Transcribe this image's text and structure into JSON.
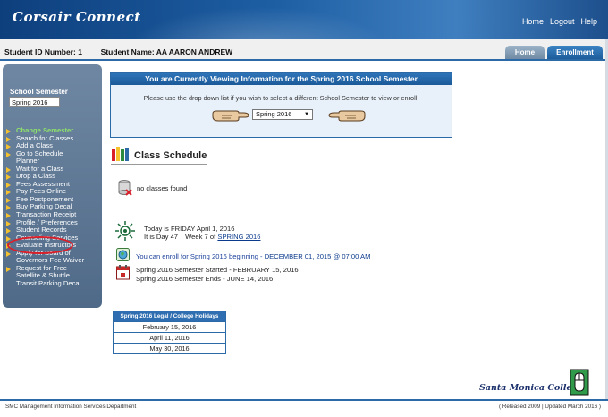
{
  "header": {
    "logo_text": "Corsair Connect",
    "nav": [
      "Home",
      "Logout",
      "Help"
    ]
  },
  "student": {
    "id_label": "Student ID Number:",
    "id_value": "1",
    "name_label": "Student Name:",
    "name_value": "AA AARON ANDREW"
  },
  "tabs": [
    "Home",
    "Enrollment"
  ],
  "sidebar": {
    "semester_label": "School Semester",
    "semester_value": "Spring 2016",
    "menu": [
      {
        "label": "Change Semester",
        "arrow": true
      },
      {
        "label": "Search for Classes",
        "arrow": true
      },
      {
        "label": "Add a Class",
        "arrow": true
      },
      {
        "label": "Go to Schedule",
        "arrow": true
      },
      {
        "label": "Planner",
        "arrow": false
      },
      {
        "label": "Wait for a Class",
        "arrow": true
      },
      {
        "label": "Drop a Class",
        "arrow": true
      },
      {
        "label": "Fees Assessment",
        "arrow": true
      },
      {
        "label": "Pay Fees Online",
        "arrow": true
      },
      {
        "label": "Fee Postponement",
        "arrow": true
      },
      {
        "label": "Buy Parking Decal",
        "arrow": true
      },
      {
        "label": "Transaction Receipt",
        "arrow": true
      },
      {
        "label": "Profile / Preferences",
        "arrow": true
      },
      {
        "label": "Student Records",
        "arrow": true
      },
      {
        "label": "Counseling Services",
        "arrow": true
      },
      {
        "label": "Evaluate Instructors",
        "arrow": true
      },
      {
        "label": "Apply for Board of",
        "arrow": true
      },
      {
        "label": "Governors Fee Waiver",
        "arrow": false
      },
      {
        "label": "Request for Free",
        "arrow": true
      },
      {
        "label": "Satellite & Shuttle",
        "arrow": false
      },
      {
        "label": "Transit Parking Decal",
        "arrow": false
      }
    ]
  },
  "semester_panel": {
    "title": "You are Currently Viewing Information for the Spring 2016 School Semester",
    "instruction": "Please use the drop down list if you wish to select a different School Semester to view or enroll.",
    "selected": "Spring 2016"
  },
  "schedule": {
    "title": "Class Schedule",
    "no_classes": "no classes found",
    "today_line1_prefix": "Today is",
    "today_line1_value": "FRIDAY April 1, 2016",
    "today_line2_prefix": "It is Day",
    "day_number": "47",
    "week_label": "Week",
    "week_number": "7",
    "of_label": "of",
    "semester_link": "SPRING 2016",
    "enroll_prefix": "You can enroll for Spring 2016 beginning",
    "enroll_link": "DECEMBER 01, 2015 @ 07:00 AM",
    "started": "Spring 2016 Semester Started - FEBRUARY 15, 2016",
    "ends": "Spring 2016 Semester Ends - JUNE 14, 2016"
  },
  "holidays": {
    "header": "Spring 2016 Legal / College Holidays",
    "dates": [
      "February 15, 2016",
      "April 11, 2016",
      "May 30, 2016"
    ]
  },
  "footer": {
    "college": "Santa Monica College",
    "left": "SMC Management Information Services Department",
    "right": "( Released 2009 | Updated March 2016 )"
  }
}
